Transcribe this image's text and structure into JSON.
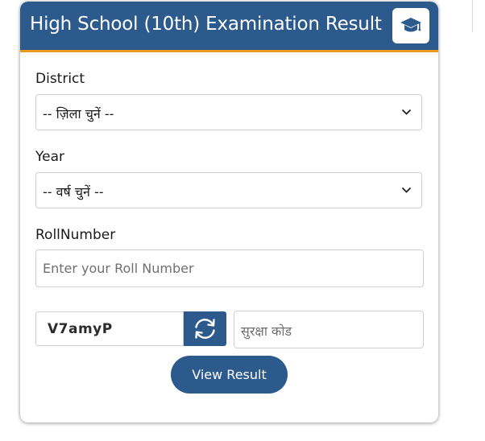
{
  "card": {
    "title": "High School (10th) Examination Result",
    "title_icon": "graduation-cap-icon"
  },
  "form": {
    "district": {
      "label": "District",
      "selected": "-- ज़िला चुनें --"
    },
    "year": {
      "label": "Year",
      "selected": "-- वर्ष चुनें --"
    },
    "roll_number": {
      "label": "RollNumber",
      "placeholder": "Enter your Roll Number",
      "value": ""
    },
    "captcha": {
      "code": "V7amyP",
      "refresh_icon": "refresh-icon",
      "input_placeholder": "सुरक्षा कोड",
      "input_value": ""
    },
    "submit_label": "View Result"
  },
  "colors": {
    "header_bg": "#2d5a8c",
    "header_accent": "#e89a1c",
    "button_bg": "#2d5a8c"
  }
}
